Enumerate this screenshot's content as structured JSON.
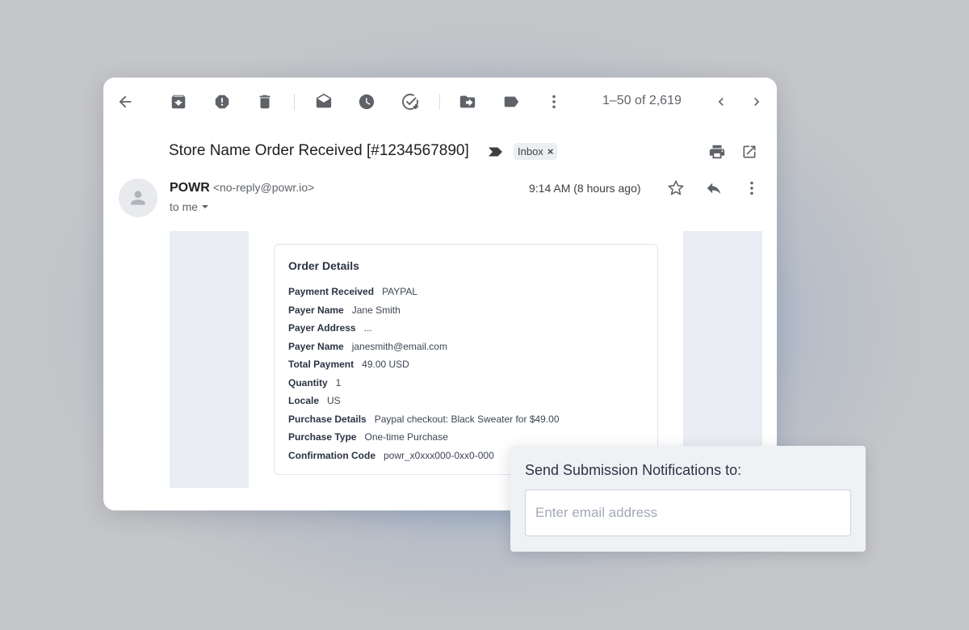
{
  "toolbar": {
    "icons": [
      "back-arrow-icon",
      "archive-icon",
      "report-spam-icon",
      "delete-icon",
      "mark-unread-icon",
      "snooze-icon",
      "add-task-icon",
      "move-to-icon",
      "label-icon",
      "more-vert-icon"
    ],
    "pager": "1–50 of 2,619"
  },
  "email": {
    "subject": "Store Name Order Received [#1234567890]",
    "label": "Inbox",
    "label_remove": "×",
    "sender_name": "POWR",
    "sender_email": "<no-reply@powr.io>",
    "recipient": "to me",
    "time": "9:14 AM (8 hours ago)"
  },
  "order": {
    "title": "Order Details",
    "rows": [
      {
        "key": "Payment Received",
        "value": "PAYPAL"
      },
      {
        "key": "Payer Name",
        "value": "Jane Smith"
      },
      {
        "key": "Payer Address",
        "value": "..."
      },
      {
        "key": "Payer Name",
        "value": "janesmith@email.com"
      },
      {
        "key": "Total Payment",
        "value": "49.00 USD"
      },
      {
        "key": "Quantity",
        "value": "1"
      },
      {
        "key": "Locale",
        "value": "US"
      },
      {
        "key": "Purchase Details",
        "value": "Paypal checkout: Black Sweater for $49.00"
      },
      {
        "key": "Purchase Type",
        "value": "One-time Purchase"
      },
      {
        "key": "Confirmation Code",
        "value": "powr_x0xxx000-0xx0-000"
      }
    ]
  },
  "notify": {
    "title": "Send Submission Notifications to:",
    "placeholder": "Enter email address",
    "value": ""
  }
}
